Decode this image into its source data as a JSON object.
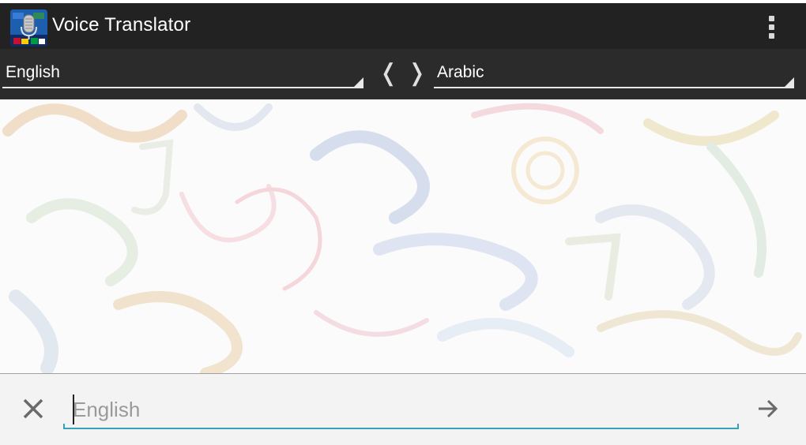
{
  "app": {
    "title": "Voice Translator",
    "icon": "microphone-flags-app-icon",
    "menu_icon": "overflow-menu-icon"
  },
  "language_bar": {
    "source_language": "English",
    "target_language": "Arabic",
    "swap_left_glyph": "❬",
    "swap_right_glyph": "❭"
  },
  "translation_area": {
    "background": "faded-calligraphy-pattern",
    "text": ""
  },
  "input_bar": {
    "clear_icon": "close-icon",
    "input_value": "",
    "input_placeholder": "English",
    "send_icon": "arrow-right-icon",
    "accent_color": "#34a2b8"
  },
  "colors": {
    "action_bar": "#222222",
    "language_bar": "#2b2b2b",
    "bottom_bar": "#f3f3f3"
  }
}
